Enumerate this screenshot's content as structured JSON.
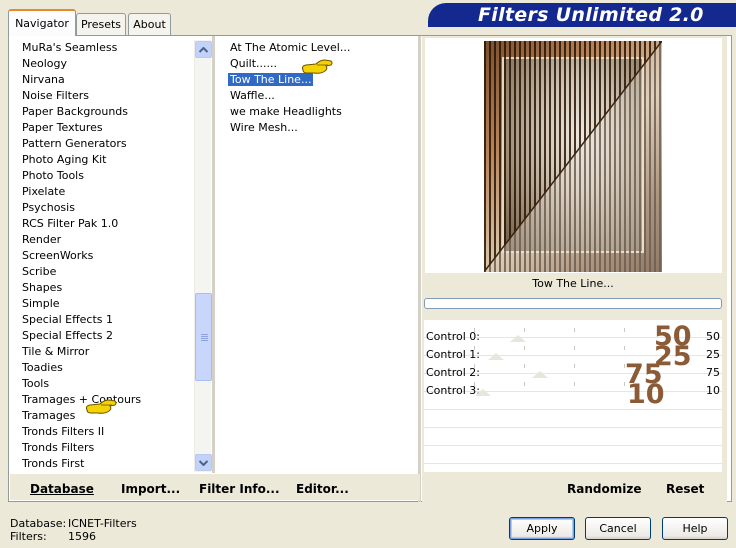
{
  "tabs": [
    {
      "label": "Navigator",
      "active": true
    },
    {
      "label": "Presets",
      "active": false
    },
    {
      "label": "About",
      "active": false
    }
  ],
  "title": "Filters Unlimited 2.0",
  "categories": [
    "MuRa's Seamless",
    "Neology",
    "Nirvana",
    "Noise Filters",
    "Paper Backgrounds",
    "Paper Textures",
    "Pattern Generators",
    "Photo Aging Kit",
    "Photo Tools",
    "Pixelate",
    "Psychosis",
    "RCS Filter Pak 1.0",
    "Render",
    "ScreenWorks",
    "Scribe",
    "Shapes",
    "Simple",
    "Special Effects 1",
    "Special Effects 2",
    "Tile & Mirror",
    "Toadies",
    "Tools",
    "Tramages + Contours",
    "Tramages",
    "Tronds Filters II",
    "Tronds Filters",
    "Tronds First"
  ],
  "filters": [
    "At The Atomic Level...",
    "Quilt......",
    "Tow The Line...",
    "Waffle...",
    "we make Headlights",
    "Wire Mesh..."
  ],
  "selected_filter_label": "Tow The Line...",
  "controls": [
    {
      "label": "Control 0:",
      "value": "50",
      "annotation": "50"
    },
    {
      "label": "Control 1:",
      "value": "25",
      "annotation": "25"
    },
    {
      "label": "Control 2:",
      "value": "75",
      "annotation": "75"
    },
    {
      "label": "Control 3:",
      "value": "10",
      "annotation": "10"
    }
  ],
  "bottom_bar": {
    "database": "Database",
    "import": "Import...",
    "filter_info": "Filter Info...",
    "editor": "Editor...",
    "randomize": "Randomize",
    "reset": "Reset"
  },
  "info": {
    "database_label": "Database:",
    "database_value": "ICNET-Filters",
    "filters_label": "Filters:",
    "filters_value": "1596"
  },
  "dialog_buttons": {
    "apply": "Apply",
    "cancel": "Cancel",
    "help": "Help"
  },
  "colors": {
    "title_bg": "#14298F",
    "selection": "#316AC5",
    "annotation": "#8B5A36"
  }
}
